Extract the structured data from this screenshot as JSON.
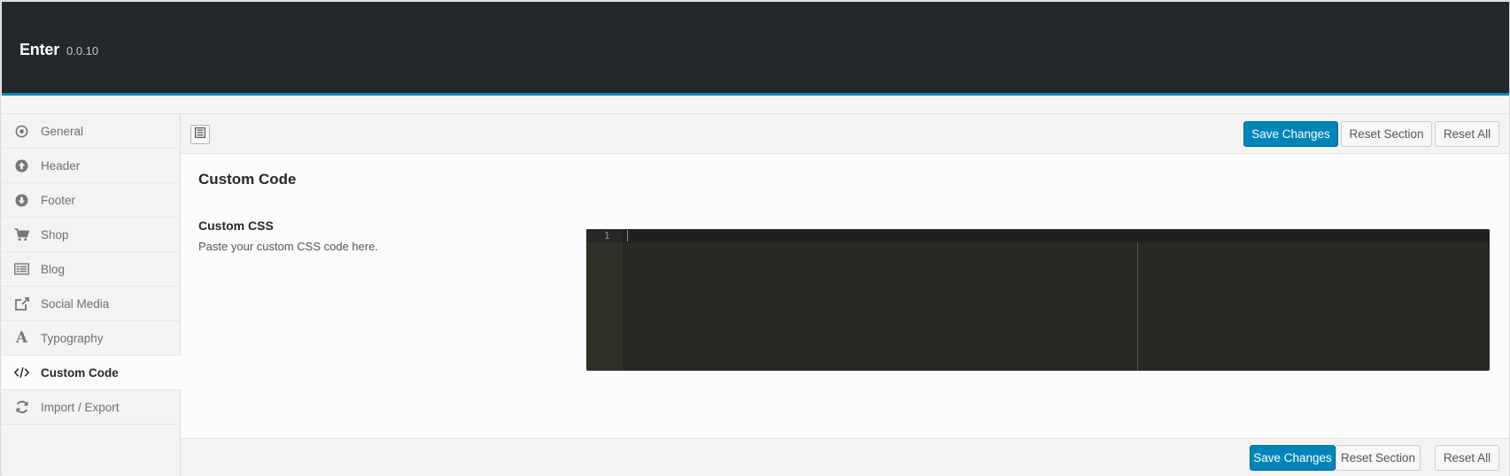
{
  "app": {
    "title": "Enter",
    "version": "0.0.10"
  },
  "sidebar": {
    "items": [
      {
        "label": "General",
        "icon": "target-icon"
      },
      {
        "label": "Header",
        "icon": "arrow-up-circle-icon"
      },
      {
        "label": "Footer",
        "icon": "arrow-down-circle-icon"
      },
      {
        "label": "Shop",
        "icon": "cart-icon"
      },
      {
        "label": "Blog",
        "icon": "list-icon"
      },
      {
        "label": "Social Media",
        "icon": "share-icon"
      },
      {
        "label": "Typography",
        "icon": "font-icon"
      },
      {
        "label": "Custom Code",
        "icon": "code-icon",
        "active": true
      },
      {
        "label": "Import / Export",
        "icon": "refresh-icon"
      }
    ]
  },
  "toolbar": {
    "save_label": "Save Changes",
    "reset_section_label": "Reset Section",
    "reset_all_label": "Reset All"
  },
  "section": {
    "title": "Custom Code",
    "field": {
      "title": "Custom CSS",
      "description": "Paste your custom CSS code here.",
      "editor_line_number": "1",
      "editor_value": ""
    }
  },
  "footer": {
    "save_label": "Save Changes",
    "reset_section_label": "Reset Section",
    "reset_all_label": "Reset All"
  },
  "colors": {
    "header_bg": "#23282d",
    "accent": "#0085ba",
    "editor_bg": "#272822"
  }
}
